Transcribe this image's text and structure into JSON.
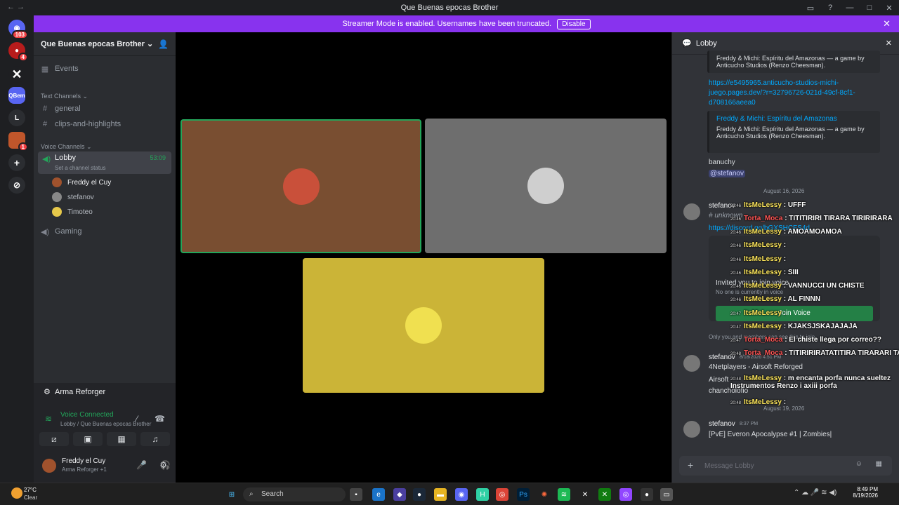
{
  "window": {
    "title": "Que Buenas epocas Brother"
  },
  "banner": {
    "text": "Streamer Mode is enabled. Usernames have been truncated.",
    "button": "Disable"
  },
  "guilds": {
    "mention_badge": "103",
    "red_badge": "4",
    "qbem_label": "QBem",
    "l_label": "L",
    "food_badge": "1"
  },
  "server": {
    "name": "Que Buenas epocas Brother",
    "events": "Events",
    "text_category": "Text Channels",
    "text_channels": [
      "general",
      "clips-and-highlights"
    ],
    "voice_category": "Voice Channels",
    "lobby": {
      "name": "Lobby",
      "time": "53:09",
      "status": "Set a channel status"
    },
    "voice_users": [
      "Freddy el Cuy",
      "stefanov",
      "Timoteo"
    ],
    "gaming": "Gaming"
  },
  "activity": {
    "game": "Arma Reforger"
  },
  "voice": {
    "status": "Voice Connected",
    "location": "Lobby / Que Buenas epocas Brother"
  },
  "me": {
    "name": "Freddy el Cuy",
    "sub": "Arma Reforger +1"
  },
  "chat": {
    "title": "Lobby",
    "embed1_desc": "Freddy & Michi: Espíritu del Amazonas — a game by Anticucho Studios (Renzo Cheesman).",
    "link": "https://e5495965.anticucho-studios-michi-juego.pages.dev/?r=32796726-021d-49cf-8cf1-d708166aeea0",
    "embed2_title": "Freddy & Michi: Espíritu del Amazonas",
    "embed2_desc": "Freddy & Michi: Espíritu del Amazonas — a game by Anticucho Studios (Renzo Cheesman).",
    "banuchy": "banuchy",
    "mention": "@stefanov",
    "date1": "August 16, 2026",
    "author1": "stefanov",
    "unknown": "# unknown",
    "discord_link": "https://discord.gg/bGXSHCFS4d",
    "invited": "Invited you to join voice",
    "no_one": "No one is currently in voice",
    "join": "Join Voice",
    "only_you": "Only you and members can see this to join",
    "author2": "stefanov",
    "time2": "8/18/2026 4:51 PM",
    "line2a": "4Netplayers - Airsoft Reforged",
    "line2b": "Airsoft",
    "line2c": "chancholofio",
    "date2": "August 19, 2026",
    "author3": "stefanov",
    "time3": "8:37 PM",
    "text3": "[PvE] Everon Apocalypse #1 | Zombies|",
    "placeholder": "Message Lobby"
  },
  "overlay": [
    {
      "t": "20:46",
      "name": "ItsMeLessy",
      "msg": ": UFFF",
      "red": false
    },
    {
      "t": "20:46",
      "name": "Torta_Moca",
      "msg": ": TITITIRIRI TIRARA TIRIRIRARA",
      "red": true
    },
    {
      "t": "20:46",
      "name": "ItsMeLessy",
      "msg": ": AMOAMOAMOA",
      "red": false
    },
    {
      "t": "20:46",
      "name": "ItsMeLessy",
      "msg": ":",
      "red": false
    },
    {
      "t": "20:46",
      "name": "ItsMeLessy",
      "msg": ":",
      "red": false
    },
    {
      "t": "20:46",
      "name": "ItsMeLessy",
      "msg": ": SIII",
      "red": false
    },
    {
      "t": "20:46",
      "name": "ItsMeLessy",
      "msg": ": VANNUCCI UN CHISTE",
      "red": false
    },
    {
      "t": "20:46",
      "name": "ItsMeLessy",
      "msg": ": AL FINNN",
      "red": false
    },
    {
      "t": "20:47",
      "name": "ItsMeLessy",
      "msg": ":",
      "red": false
    },
    {
      "t": "20:47",
      "name": "ItsMeLessy",
      "msg": ": KJAKSJSKAJAJAJA",
      "red": false
    },
    {
      "t": "20:47",
      "name": "Torta_Moca",
      "msg": ": El chiste llega por correo??",
      "red": true
    },
    {
      "t": "20:48",
      "name": "Torta_Moca",
      "msg": ": TITIRIRIRATATITIRA TIRARARI TATARIRIRA",
      "red": true
    },
    {
      "t": "20:48",
      "name": "ItsMeLessy",
      "msg": ": m encanta porfa nunca sueltez Instrumentos Renzo i axiii porfa",
      "red": false
    },
    {
      "t": "20:48",
      "name": "ItsMeLessy",
      "msg": ":",
      "red": false
    }
  ],
  "taskbar": {
    "weather": "27°C",
    "weather_desc": "Clear",
    "search": "Search",
    "time": "8:49 PM",
    "date": "8/19/2026"
  }
}
